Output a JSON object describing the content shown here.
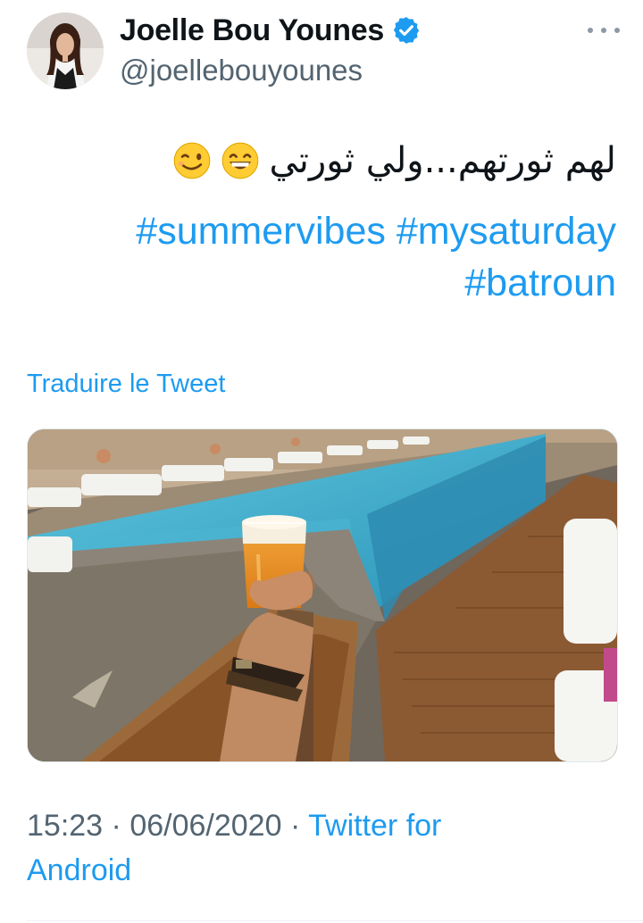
{
  "author": {
    "display_name": "Joelle Bou Younes",
    "handle": "@joellebouyounes",
    "verified": true,
    "verified_icon": "verified-badge-icon",
    "avatar_icon": "profile-avatar",
    "more_icon": "more-options-icon"
  },
  "tweet": {
    "arabic_text": "لهم ثورتهم...ولي ثورتي",
    "emojis": [
      "grinning-face-with-smiling-eyes-emoji",
      "winking-face-emoji"
    ],
    "hashtag_lines": [
      [
        "#summervibes",
        "#mysaturday"
      ],
      [
        "#batroun"
      ]
    ],
    "translate_label": "Traduire le Tweet",
    "media": {
      "description_icon": "pool-photo-with-beer-image"
    }
  },
  "meta": {
    "time": "15:23",
    "date": "06/06/2020",
    "separator": "·",
    "source_line1": "Twitter for",
    "source_line2": "Android"
  },
  "colors": {
    "link": "#1d9bf0",
    "secondary_text": "#536471",
    "primary_text": "#0f1419"
  }
}
